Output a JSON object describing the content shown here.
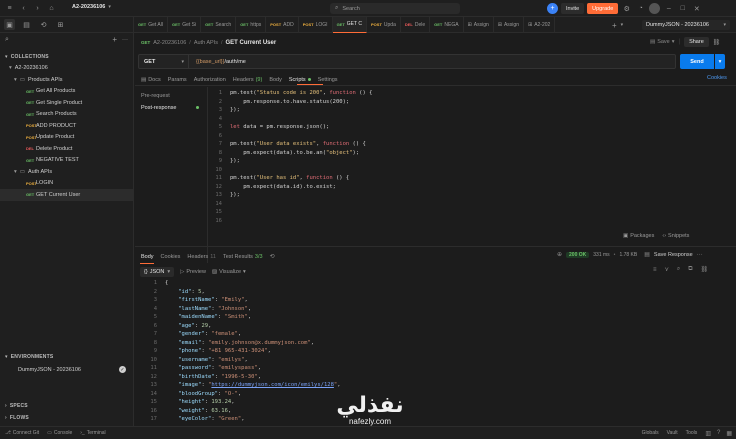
{
  "app": {
    "workspace": "A2-20236106",
    "search_placeholder": "Search",
    "invite_label": "Invite",
    "upgrade_label": "Upgrade",
    "accent": "#ff6c37",
    "send_color": "#097bed"
  },
  "tabs": [
    {
      "method": "GET",
      "label": "Get All"
    },
    {
      "method": "GET",
      "label": "Get Si"
    },
    {
      "method": "GET",
      "label": "Search"
    },
    {
      "method": "GET",
      "label": "https"
    },
    {
      "method": "POST",
      "label": "ADD"
    },
    {
      "method": "POST",
      "label": "LOGI"
    },
    {
      "method": "GET",
      "label": "GET C"
    },
    {
      "method": "POST",
      "label": "Upda"
    },
    {
      "method": "DEL",
      "label": "Dele"
    },
    {
      "method": "GET",
      "label": "NEGA"
    },
    {
      "method": "",
      "label": "Assign"
    },
    {
      "method": "",
      "label": "Assign"
    },
    {
      "method": "",
      "label": "A2-202"
    }
  ],
  "env_select": "DummyJSON - 20236106",
  "sidebar": {
    "collections_label": "COLLECTIONS",
    "collection_name": "A2-20236106",
    "folder1": "Products APIs",
    "products": [
      {
        "method": "GET",
        "label": "Get All Products"
      },
      {
        "method": "GET",
        "label": "Get Single Product"
      },
      {
        "method": "GET",
        "label": "Search Products"
      },
      {
        "method": "POST",
        "label": "ADD PRODUCT"
      },
      {
        "method": "POST",
        "label": "Update Product"
      },
      {
        "method": "DEL",
        "label": "Delete Product"
      },
      {
        "method": "GET",
        "label": "NEGATIVE TEST"
      }
    ],
    "folder2": "Auth APIs",
    "auth": [
      {
        "method": "POST",
        "label": "LOGIN"
      },
      {
        "method": "GET",
        "label": "GET Current User"
      }
    ],
    "environments_label": "ENVIRONMENTS",
    "environment": "DummyJSON - 20236106",
    "specs_label": "SPECS",
    "flows_label": "FLOWS"
  },
  "breadcrumb": {
    "collection": "A2-20236106",
    "folder": "Auth APIs",
    "request": "GET Current User"
  },
  "request": {
    "save_label": "Save",
    "share_label": "Share",
    "method": "GET",
    "url_var": "{{base_url}}",
    "url_path": "/auth/me",
    "send_label": "Send",
    "cookies_label": "Cookies",
    "docs_label": "Docs",
    "params_label": "Params",
    "auth_label": "Authorization",
    "headers_label": "Headers",
    "headers_count": "(9)",
    "body_label": "Body",
    "scripts_label": "Scripts",
    "settings_label": "Settings",
    "prerequest_label": "Pre-request",
    "postresponse_label": "Post-response",
    "packages_label": "Packages",
    "snippets_label": "Snippets"
  },
  "script_lines": [
    "1",
    "2",
    "3",
    "4",
    "5",
    "6",
    "7",
    "8",
    "9",
    "10",
    "11",
    "12",
    "13",
    "14",
    "15",
    "16"
  ],
  "response": {
    "body_tab": "Body",
    "cookies_tab": "Cookies",
    "headers_tab": "Headers",
    "headers_count": "11",
    "tests_tab": "Test Results",
    "tests_count": "3/3",
    "status": "200 OK",
    "time": "331 ms",
    "size": "1.78 KB",
    "save_label": "Save Response",
    "format": "JSON",
    "preview_label": "Preview",
    "visualize_label": "Visualize"
  },
  "statusbar": {
    "connect": "Connect Git",
    "console": "Console",
    "terminal": "Terminal",
    "globals": "Globals",
    "vault": "Vault",
    "tools": "Tools"
  },
  "watermark": {
    "arabic": "نفذلي",
    "latin": "nafezly.com"
  }
}
